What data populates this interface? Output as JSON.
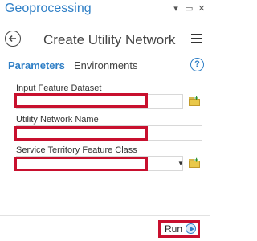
{
  "pane": {
    "title": "Geoprocessing",
    "controls": [
      "▾",
      "▭",
      "✕"
    ]
  },
  "tool": {
    "title": "Create Utility Network"
  },
  "tabs": {
    "parameters": "Parameters",
    "environments": "Environments",
    "help": "?"
  },
  "params": [
    {
      "label": "Input Feature Dataset",
      "value": ""
    },
    {
      "label": "Utility Network Name",
      "value": ""
    },
    {
      "label": "Service Territory Feature Class",
      "value": ""
    }
  ],
  "footer": {
    "run_label": "Run"
  },
  "colors": {
    "accent": "#2f7fc6",
    "highlight": "#c8102e"
  }
}
